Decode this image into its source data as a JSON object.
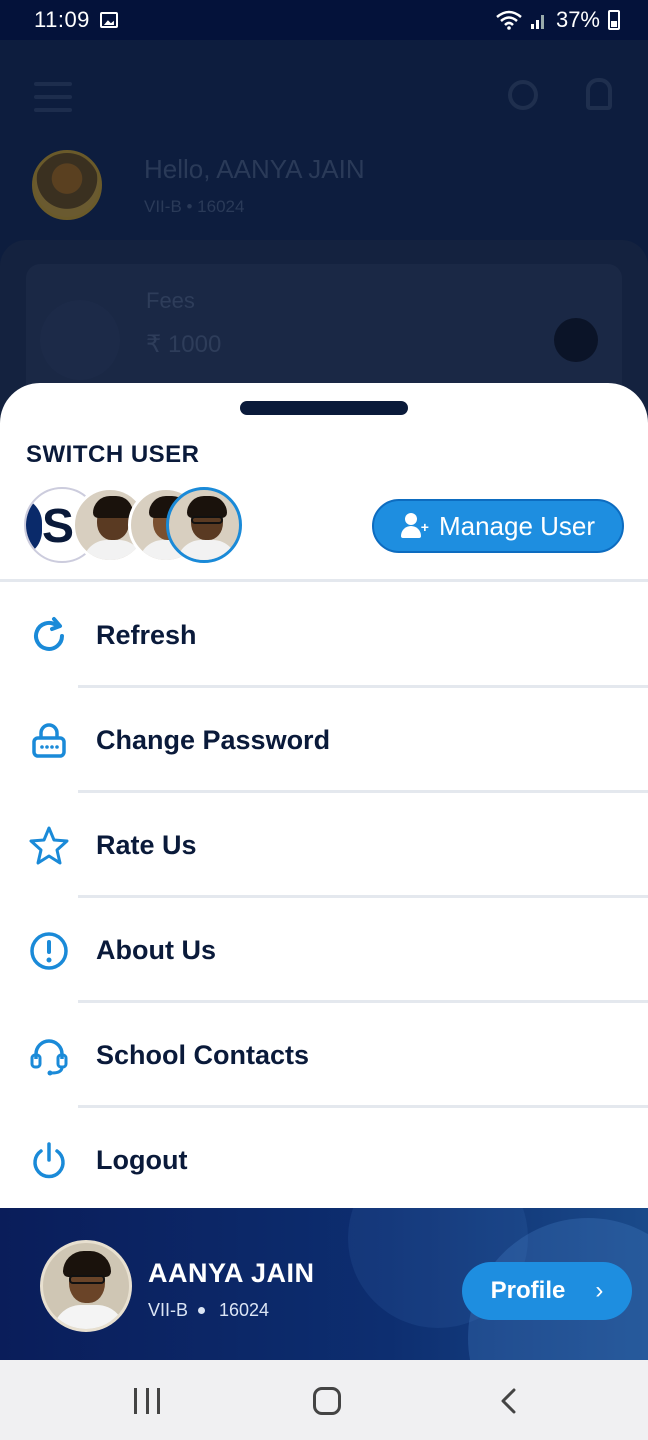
{
  "status_bar": {
    "time": "11:09",
    "battery": "37%"
  },
  "background": {
    "greeting": "Hello, AANYA JAIN",
    "greeting_sub": "VII-B  •  16024",
    "fees_label": "Fees",
    "fees_amount": "₹ 1000"
  },
  "sheet": {
    "switch_user_title": "SWITCH USER",
    "manage_user_label": "Manage User",
    "menu": [
      {
        "label": "Refresh",
        "icon": "refresh-icon"
      },
      {
        "label": "Change Password",
        "icon": "lock-icon"
      },
      {
        "label": "Rate Us",
        "icon": "star-icon"
      },
      {
        "label": "About Us",
        "icon": "info-icon"
      },
      {
        "label": "School Contacts",
        "icon": "headset-icon"
      },
      {
        "label": "Logout",
        "icon": "power-icon"
      }
    ]
  },
  "profile": {
    "name": "AANYA JAIN",
    "class": "VII-B",
    "roll": "16024",
    "button_label": "Profile"
  },
  "colors": {
    "accent": "#1e8ee0",
    "navy": "#0a1a3a",
    "icon_blue": "#1a8ad8"
  }
}
